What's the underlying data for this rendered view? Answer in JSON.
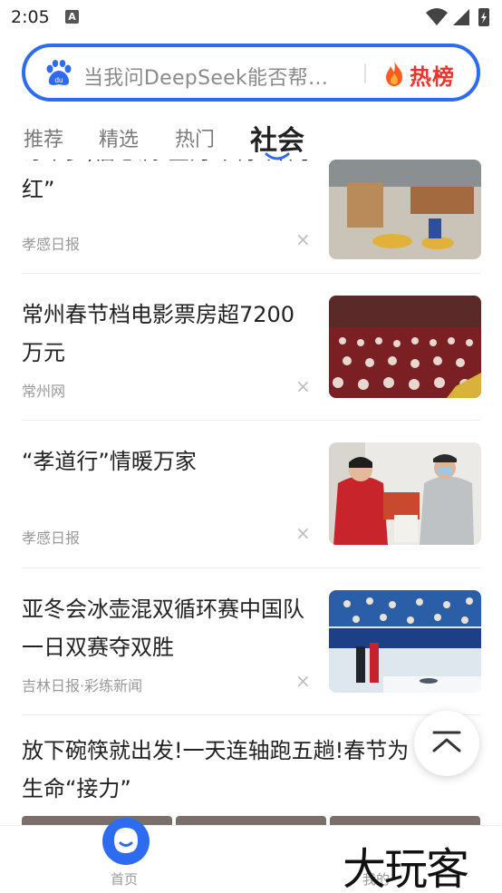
{
  "status_bar": {
    "time": "2:05",
    "notification_icon": "A"
  },
  "search": {
    "logo_text": "du",
    "placeholder": "当我问DeepSeek能否帮…",
    "hot_label": "热榜",
    "accent_color": "#2d6cf0",
    "hot_color": "#f0342c"
  },
  "tabs": [
    {
      "label": "推荐"
    },
    {
      "label": "精选"
    },
    {
      "label": "热门"
    },
    {
      "label": "社会",
      "active": true
    }
  ],
  "news": [
    {
      "title": "订单多,信心满!全力冲刺“开门红”",
      "source": "孝感日报",
      "close": "×"
    },
    {
      "title": "常州春节档电影票房超7200万元",
      "source": "常州网",
      "close": "×"
    },
    {
      "title": "“孝道行”情暖万家",
      "source": "孝感日报",
      "close": "×"
    },
    {
      "title": "亚冬会冰壶混双循环赛中国队一日双赛夺双胜",
      "source": "吉林日报·彩练新闻",
      "close": "×"
    },
    {
      "title": "放下碗筷就出发!一天连轴跑五趟!春节为生命“接力”"
    }
  ],
  "bottom_nav": {
    "home_label": "首页",
    "mine_label": "我的",
    "watermark": "大玩客"
  }
}
